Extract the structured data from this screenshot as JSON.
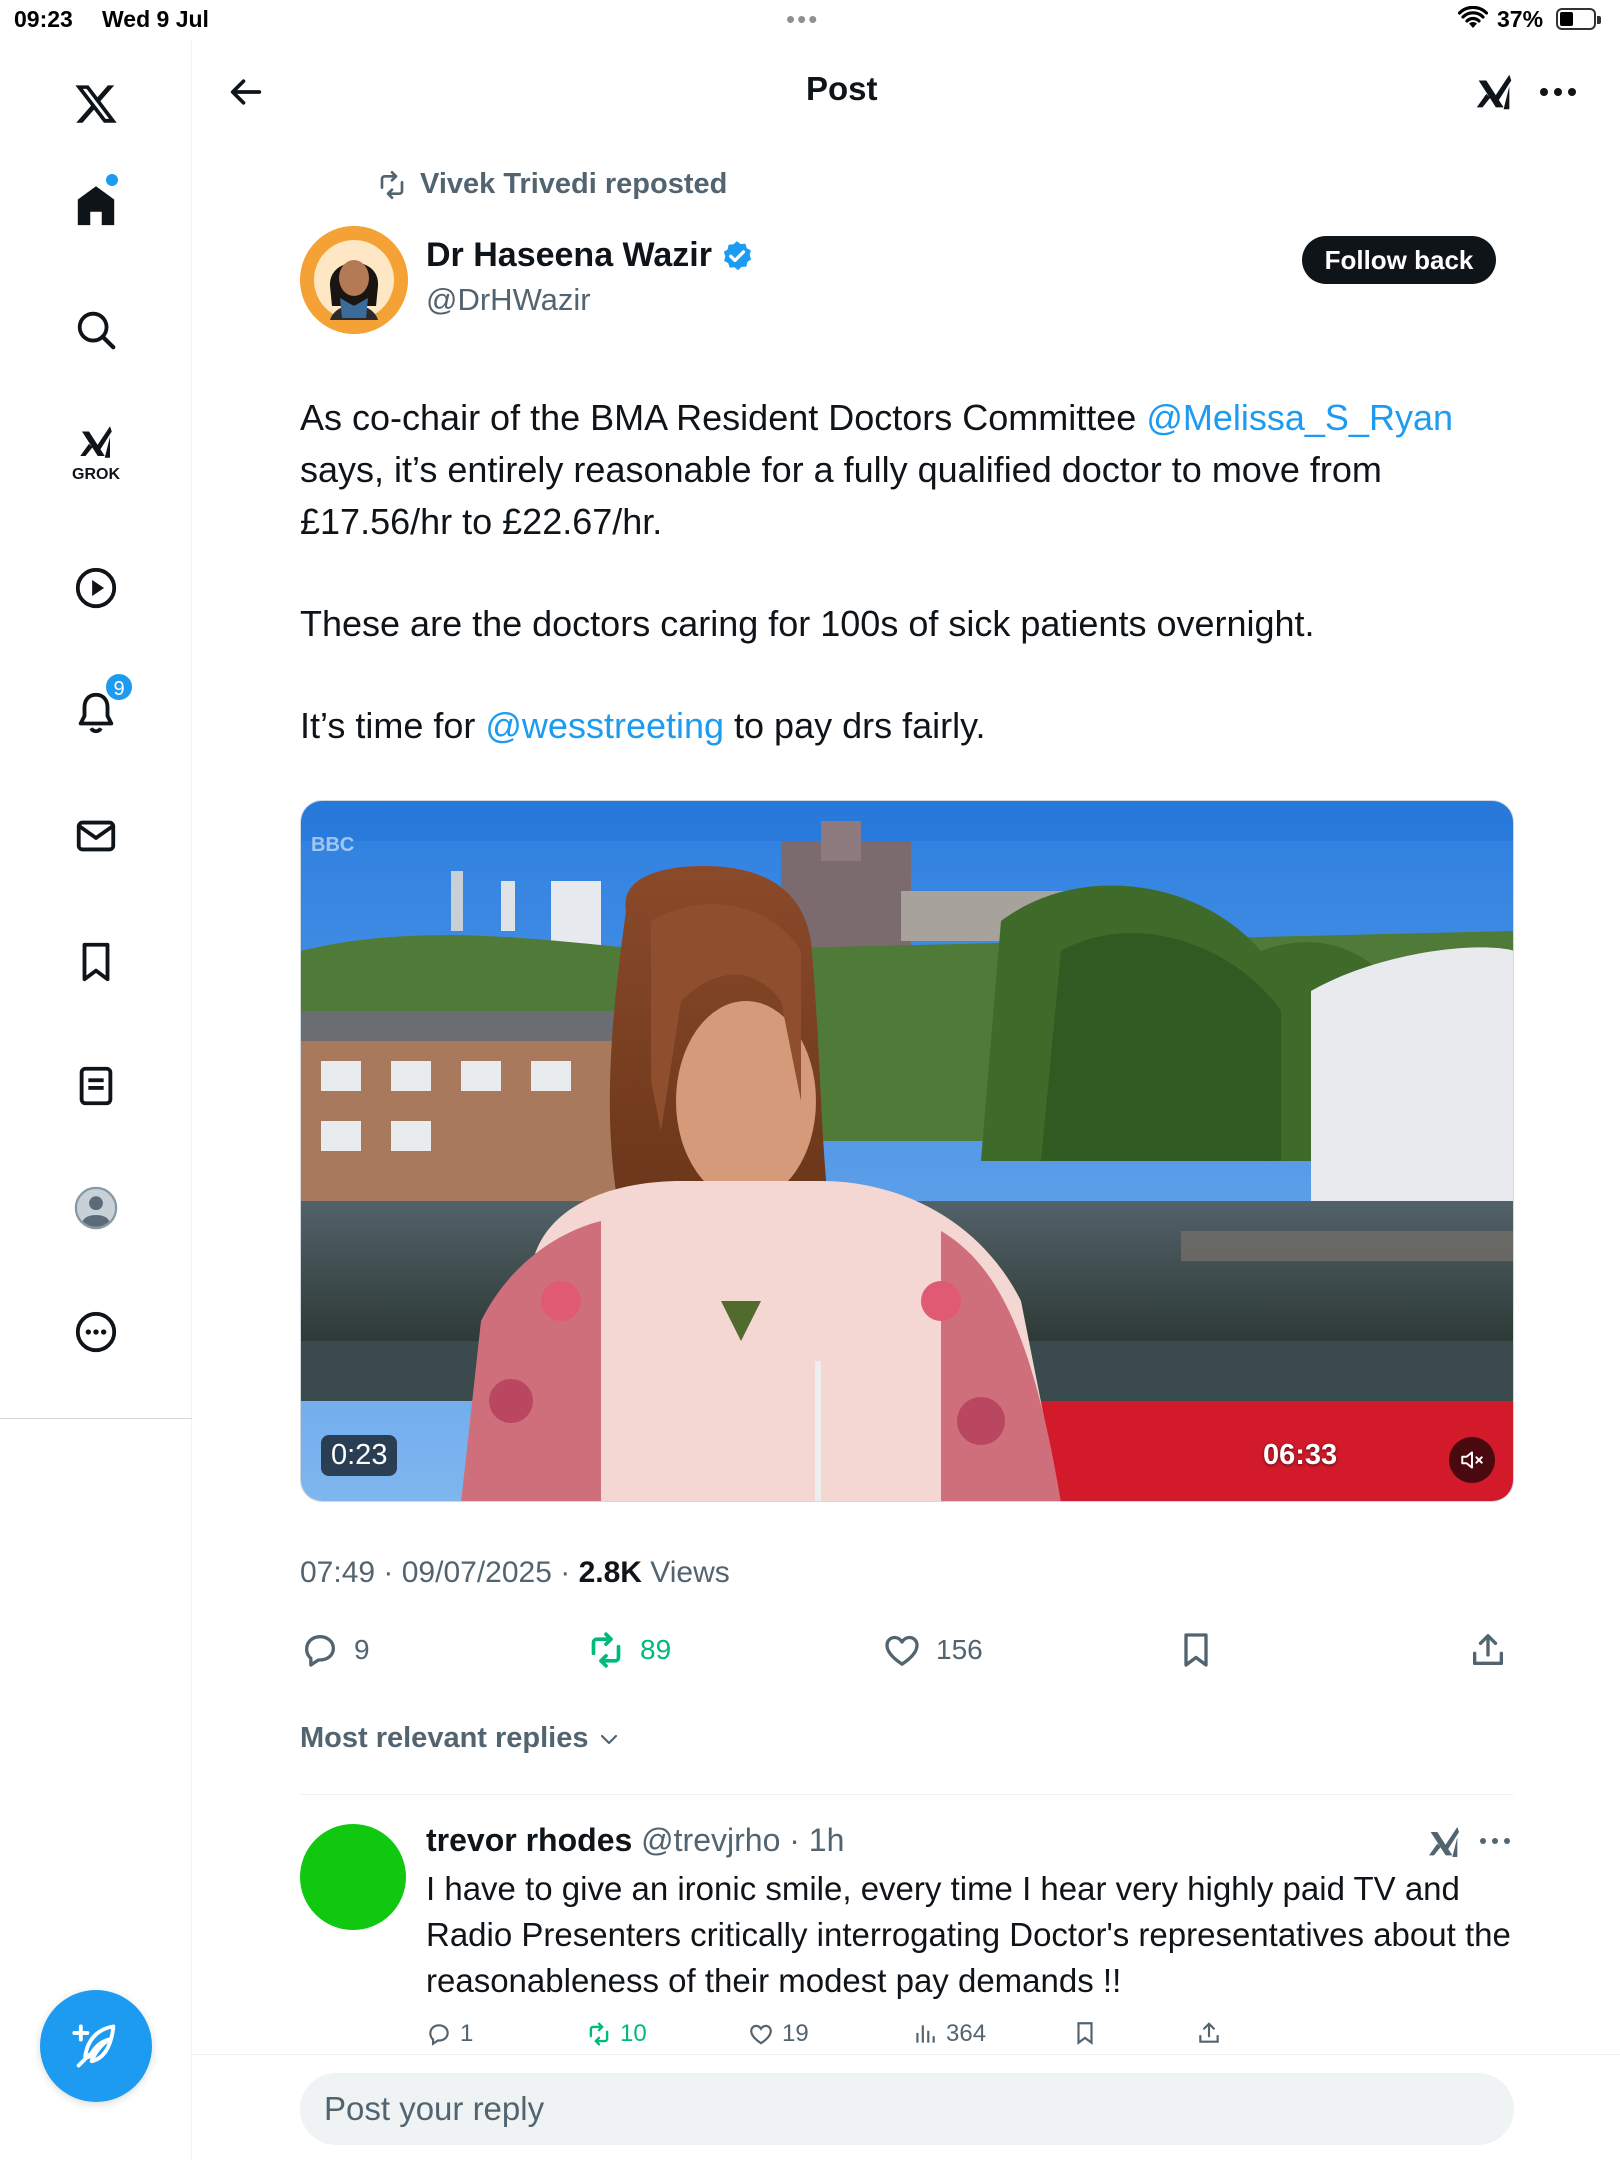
{
  "status_bar": {
    "time": "09:23",
    "date": "Wed 9 Jul",
    "battery": "37%"
  },
  "sidebar": {
    "items": [
      {
        "name": "home",
        "icon": "home-icon"
      },
      {
        "name": "explore",
        "icon": "search-icon"
      },
      {
        "name": "grok",
        "icon": "grok-icon",
        "label": "GROK"
      },
      {
        "name": "video",
        "icon": "play-icon"
      },
      {
        "name": "notifications",
        "icon": "bell-icon",
        "badge": "9"
      },
      {
        "name": "messages",
        "icon": "mail-icon"
      },
      {
        "name": "bookmarks",
        "icon": "bookmark-icon"
      },
      {
        "name": "lists",
        "icon": "list-icon"
      },
      {
        "name": "profile",
        "icon": "avatar-icon"
      },
      {
        "name": "more",
        "icon": "more-icon"
      }
    ],
    "compose_icon": "compose-icon"
  },
  "header": {
    "title": "Post"
  },
  "post": {
    "repost_label": "Vivek Trivedi reposted",
    "author_name": "Dr Haseena Wazir",
    "author_handle": "@DrHWazir",
    "follow_label": "Follow back",
    "body": {
      "p1_a": "As co-chair of the BMA Resident Doctors Committee ",
      "p1_mention": "@Melissa_S_Ryan",
      "p1_b": " says,  it’s entirely reasonable for a fully qualified doctor to move from £17.56/hr to £22.67/hr.",
      "p2": "These are the doctors caring for 100s of sick patients overnight.",
      "p3_a": "It’s time for ",
      "p3_mention": "@wesstreeting",
      "p3_b": " to pay drs fairly."
    },
    "video": {
      "elapsed": "0:23",
      "duration": "06:33",
      "channel_logo": "BBC"
    },
    "meta": {
      "time": "07:49",
      "date": "09/07/2025",
      "views": "2.8K",
      "views_label": "Views"
    },
    "stats": {
      "replies": "9",
      "reposts": "89",
      "likes": "156"
    },
    "colors": {
      "repost_active": "#00ba7c",
      "accent": "#1d9bf0"
    }
  },
  "replies_sort": "Most relevant replies",
  "reply": {
    "name": "trevor rhodes",
    "handle": "@trevjrho",
    "time": "1h",
    "text": "I have to give an ironic smile, every time I hear very highly paid TV and Radio Presenters critically interrogating Doctor's representatives about the reasonableness of their modest pay demands !!",
    "stats": {
      "replies": "1",
      "reposts": "10",
      "likes": "19",
      "views": "364"
    }
  },
  "reply_bar": {
    "placeholder": "Post your reply"
  }
}
